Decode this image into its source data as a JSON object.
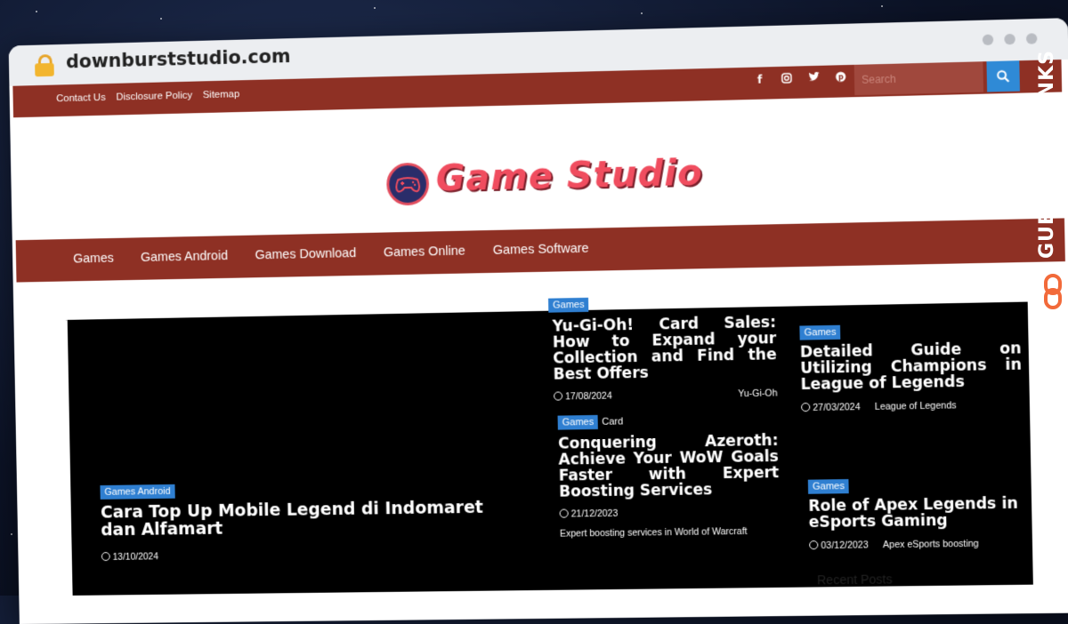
{
  "browser": {
    "url": "downburststudio.com"
  },
  "topbar": {
    "links": [
      "Contact Us",
      "Disclosure Policy",
      "Sitemap"
    ],
    "social_icons": [
      "facebook-icon",
      "instagram-icon",
      "twitter-icon",
      "pinterest-icon"
    ],
    "search_placeholder": "Search"
  },
  "logo": {
    "text": "Game Studio"
  },
  "nav": {
    "items": [
      "Games",
      "Games Android",
      "Games Download",
      "Games Online",
      "Games Software"
    ]
  },
  "featured": {
    "main": {
      "category": "Games Android",
      "title": "Cara Top Up Mobile Legend di Indomaret dan Alfamart",
      "date": "13/10/2024"
    },
    "middle_top": {
      "category": "Games",
      "title": "Yu-Gi-Oh! Card Sales: How to Expand your Collection and Find the Best Offers",
      "date": "17/08/2024",
      "tag": "Yu-Gi-Oh"
    },
    "middle_bottom": {
      "category": "Games",
      "category2": "Card",
      "title": "Conquering Azeroth: Achieve Your WoW Goals Faster with Expert Boosting Services",
      "date": "21/12/2023",
      "excerpt": "Expert boosting services in World of Warcraft"
    },
    "right_top": {
      "category": "Games",
      "title": "Detailed Guide on Utilizing Champions in League of Legends",
      "date": "27/03/2024",
      "tag": "League of Legends"
    },
    "right_bottom": {
      "category": "Games",
      "title": "Role of Apex Legends in eSports Gaming",
      "date": "03/12/2023",
      "tag": "Apex eSports boosting"
    }
  },
  "sidebar": {
    "recent_heading": "Recent Posts"
  },
  "watermark": {
    "text": "GUESTPOSTLINKS"
  },
  "colors": {
    "brand": "#8e3024",
    "accent": "#2f7fd1",
    "logo": "#f04d5f"
  }
}
